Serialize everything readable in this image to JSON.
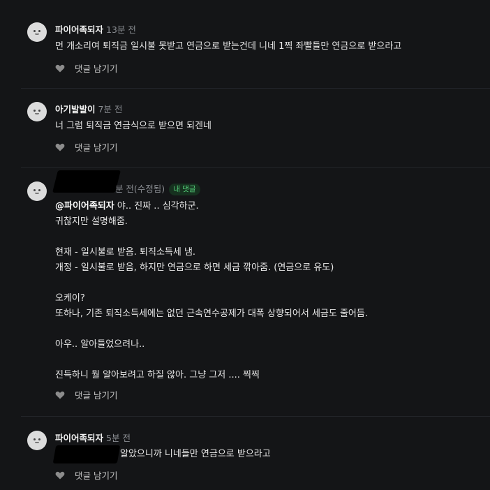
{
  "colors": {
    "background": "#141517",
    "badge_bg": "#16311f",
    "badge_text": "#57d47c",
    "muted": "#8a8d92"
  },
  "icons": {
    "like": "heart-icon",
    "avatar": "default-avatar-icon"
  },
  "comments": [
    {
      "author": "파이어족되자",
      "time": "13분 전",
      "text": "먼 개소리여 퇴직금 일시불 못받고 연금으로 받는건데 니네 1찍 좌빨들만 연금으로 받으라고",
      "reply_label": "댓글 남기기"
    },
    {
      "author": "아기발발이",
      "time": "7분 전",
      "text": "너 그럼 퇴직금 연금식으로 받으면 되겐네",
      "reply_label": "댓글 남기기"
    },
    {
      "author": "",
      "time": "7분 전(수정됨)",
      "badge": "내 댓글",
      "mention": "@파이어족되자",
      "first_line_rest": " 야.. 진짜 .. 심각하군.",
      "rest_text": "귀찮지만 설명해줌.\n\n현재 - 일시불로 받음. 퇴직소득세 냄.\n개정 - 일시불로 받음, 하지만 연금으로 하면 세금 깎아줌. (연금으로 유도)\n\n오케이?\n또하나, 기존 퇴직소득세에는 없던 근속연수공제가 대폭 상향되어서 세금도 줄어듬.\n\n아우.. 알아들었으려나..\n\n진득하니 뭘 알아보려고 하질 않아. 그냥 그저 .... 찍찍",
      "reply_label": "댓글 남기기"
    },
    {
      "author": "파이어족되자",
      "time": "5분 전",
      "text": "알았으니까 니네들만 연금으로 받으라고",
      "reply_label": "댓글 남기기"
    }
  ]
}
